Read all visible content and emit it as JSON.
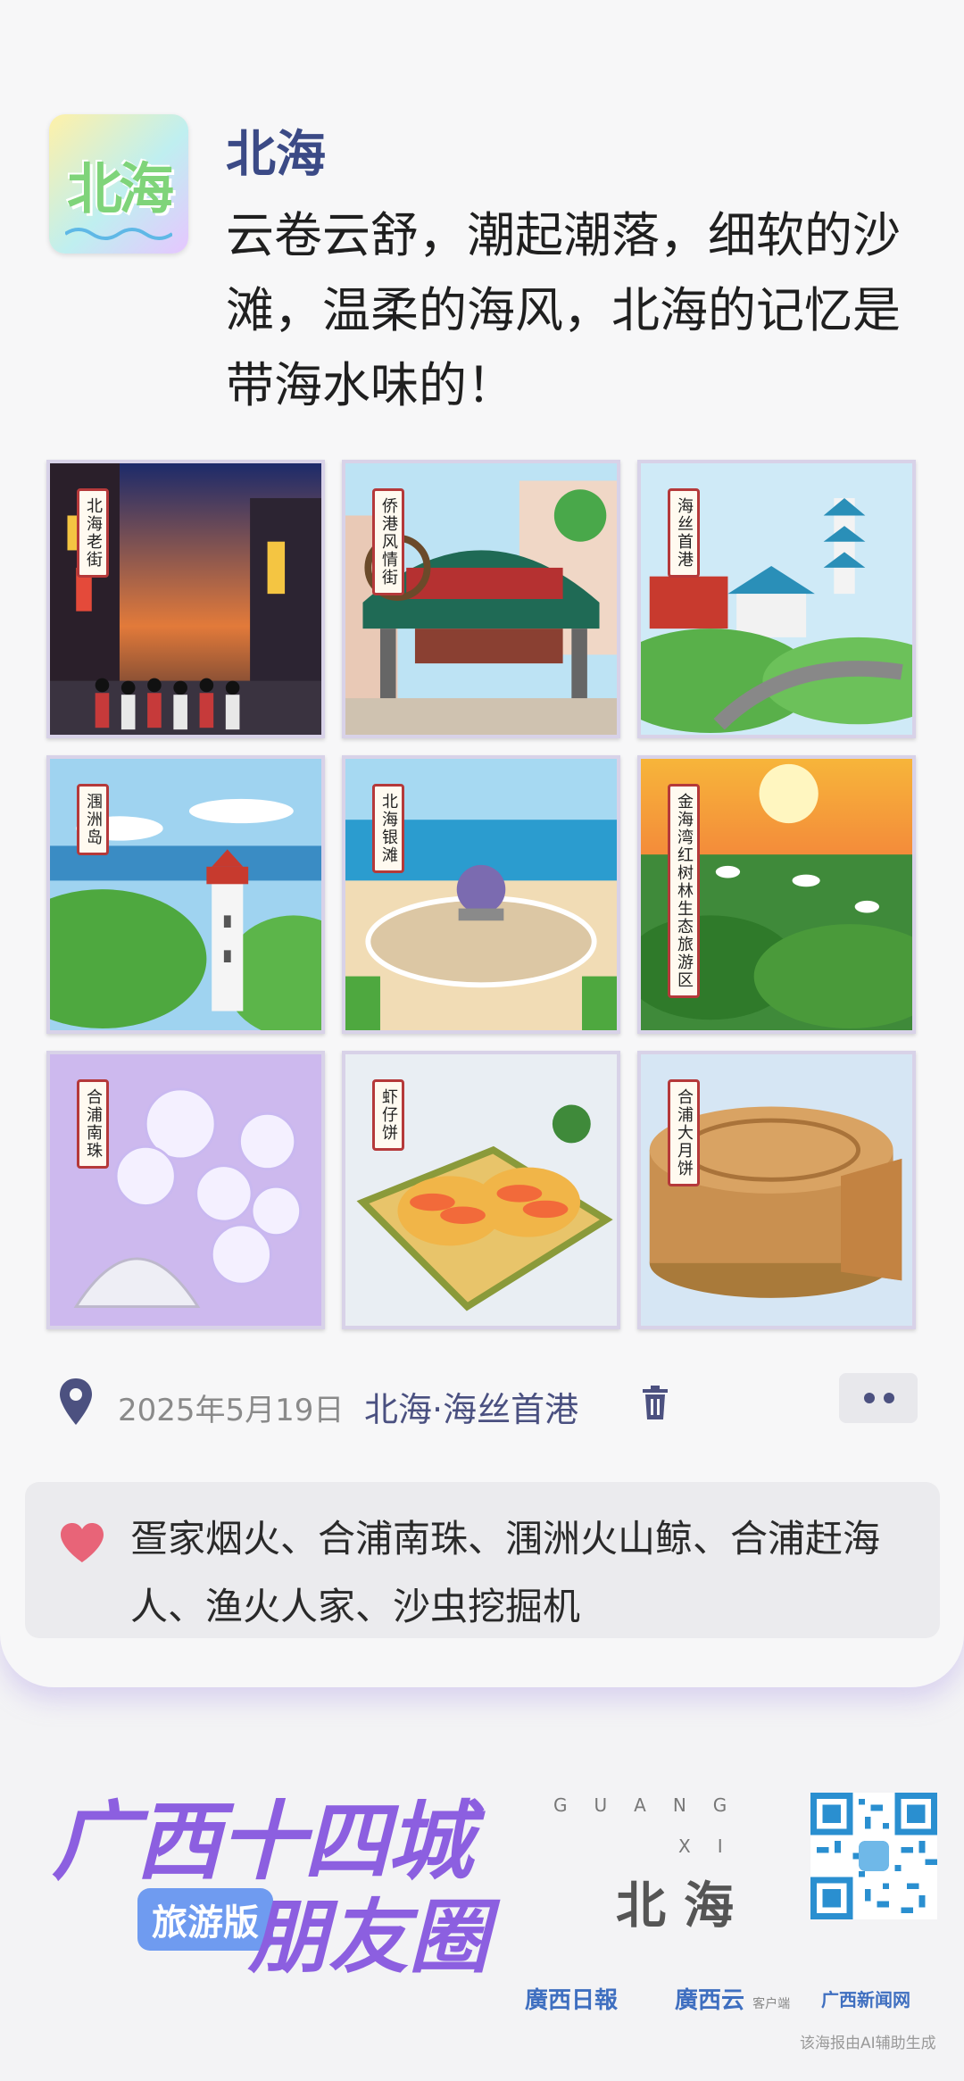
{
  "post": {
    "avatar_text": "北海",
    "user_name": "北海",
    "text": "云卷云舒，潮起潮落，细软的沙滩，温柔的海风，北海的记忆是带海水味的！"
  },
  "photos": [
    {
      "label": "北海老街",
      "scene": "night-street"
    },
    {
      "label": "侨港风情街",
      "scene": "gate-street"
    },
    {
      "label": "海丝首港",
      "scene": "pagoda-garden"
    },
    {
      "label": "涠洲岛",
      "scene": "lighthouse"
    },
    {
      "label": "北海银滩",
      "scene": "beach-plaza"
    },
    {
      "label": "金海湾红树林生态旅游区",
      "scene": "mangrove-sunset"
    },
    {
      "label": "合浦南珠",
      "scene": "pearls"
    },
    {
      "label": "虾仔饼",
      "scene": "shrimp-cake"
    },
    {
      "label": "合浦大月饼",
      "scene": "mooncake"
    }
  ],
  "meta": {
    "date": "2025年5月19日",
    "location": "北海·海丝首港"
  },
  "likes": {
    "text": "疍家烟火、合浦南珠、涠洲火山鲸、合浦赶海人、渔火人家、沙虫挖掘机"
  },
  "footer": {
    "brand_line1": "广西十四城",
    "brand_line2": "朋友圈",
    "brand_tag": "旅游版",
    "guangxi_row1": "GUANG",
    "guangxi_row2": "XI",
    "city": "北海",
    "logo1": "廣西日報",
    "logo2": "廣西云",
    "logo2_sub": "客户端",
    "logo3": "广西新闻网",
    "ai_note": "该海报由AI辅助生成"
  },
  "colors": {
    "accent": "#3b4a86",
    "brand_purple": "#8c5fe0",
    "heart": "#e86478",
    "label_border": "#b5393a"
  }
}
